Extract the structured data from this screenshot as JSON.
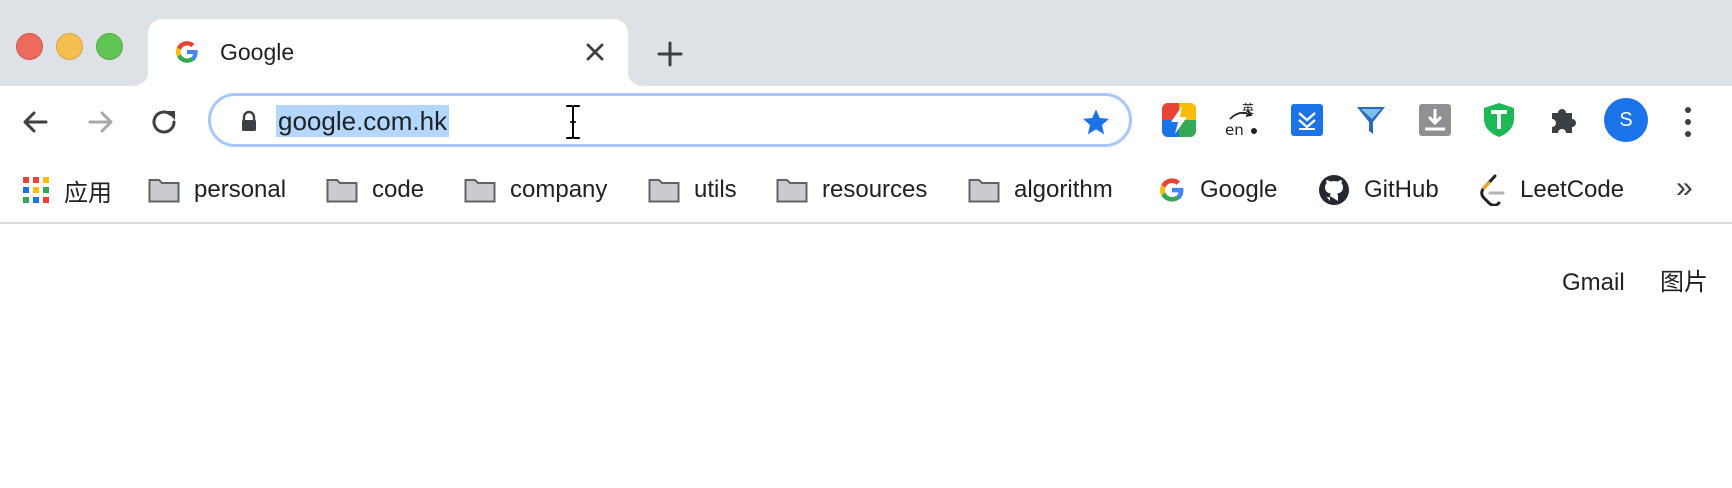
{
  "window": {
    "tab": {
      "title": "Google",
      "favicon": "google-g-icon",
      "close_icon": "close-icon"
    },
    "new_tab_icon": "plus-icon",
    "traffic_lights": {
      "close": "#ed6a5e",
      "minimize": "#f5bf4f",
      "zoom": "#61c554"
    }
  },
  "toolbar": {
    "back_icon": "arrow-left-icon",
    "forward_icon": "arrow-right-icon",
    "reload_icon": "reload-icon",
    "omnibox": {
      "url": "google.com.hk",
      "secure_icon": "lock-icon",
      "bookmark_icon": "star-icon",
      "bookmarked": true,
      "url_selected": true
    },
    "extensions": [
      "flash-colorful-ext-icon",
      "translate-en-ext-icon",
      "download-blue-ext-icon",
      "funnel-ext-icon",
      "download-gray-ext-icon",
      "shield-t-ext-icon",
      "puzzle-icon"
    ],
    "profile": {
      "initial": "S",
      "color": "#1a73e8"
    },
    "menu_icon": "kebab-menu-icon"
  },
  "bookmarks": {
    "apps_label": "应用",
    "folders": [
      "personal",
      "code",
      "company",
      "utils",
      "resources",
      "algorithm"
    ],
    "links": [
      "Google",
      "GitHub",
      "LeetCode"
    ],
    "overflow": "»"
  },
  "page": {
    "gmail": "Gmail",
    "images": "图片"
  },
  "colors": {
    "tabstrip": "#dee1e6",
    "accent": "#1a73e8",
    "selection": "#b3d7ff"
  }
}
